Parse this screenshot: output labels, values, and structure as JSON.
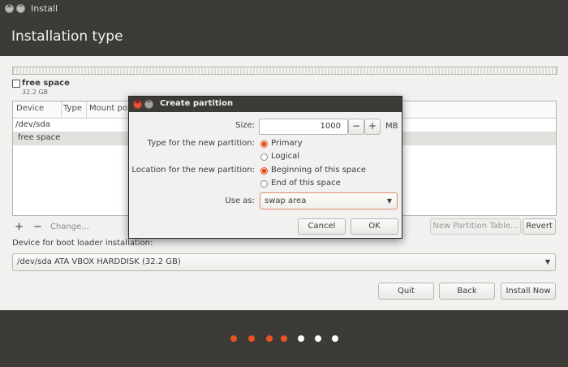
{
  "window": {
    "title": "Install"
  },
  "page": {
    "title": "Installation type"
  },
  "disk_summary": {
    "label": "free space",
    "size": "32.2 GB"
  },
  "table": {
    "columns": [
      "Device",
      "Type",
      "Mount po"
    ],
    "rows": [
      {
        "device": "/dev/sda"
      },
      {
        "device": "free space"
      }
    ]
  },
  "toolbar": {
    "add_label": "+",
    "remove_label": "−",
    "change_label": "Change...",
    "new_table_label": "New Partition Table...",
    "revert_label": "Revert"
  },
  "bootloader": {
    "label": "Device for boot loader installation:",
    "value": "/dev/sda ATA VBOX HARDDISK (32.2 GB)"
  },
  "nav": {
    "quit_label": "Quit",
    "back_label": "Back",
    "install_label": "Install Now"
  },
  "progress": {
    "total_steps": 7,
    "completed_steps": 4,
    "active_color": "#e95420",
    "inactive_color": "#ffffff"
  },
  "dialog": {
    "title": "Create partition",
    "size_label": "Size:",
    "size_value": "1000",
    "size_unit": "MB",
    "minus_label": "−",
    "plus_label": "+",
    "type_label": "Type for the new partition:",
    "type_options": [
      "Primary",
      "Logical"
    ],
    "type_selected": "Primary",
    "location_label": "Location for the new partition:",
    "location_options": [
      "Beginning of this space",
      "End of this space"
    ],
    "location_selected": "Beginning of this space",
    "use_label": "Use as:",
    "use_value": "swap area",
    "cancel_label": "Cancel",
    "ok_label": "OK"
  },
  "icons": {
    "window_close": "close-icon",
    "window_minimize": "minimize-icon",
    "dropdown": "chevron-down-icon",
    "checkbox": "checkbox-icon"
  }
}
